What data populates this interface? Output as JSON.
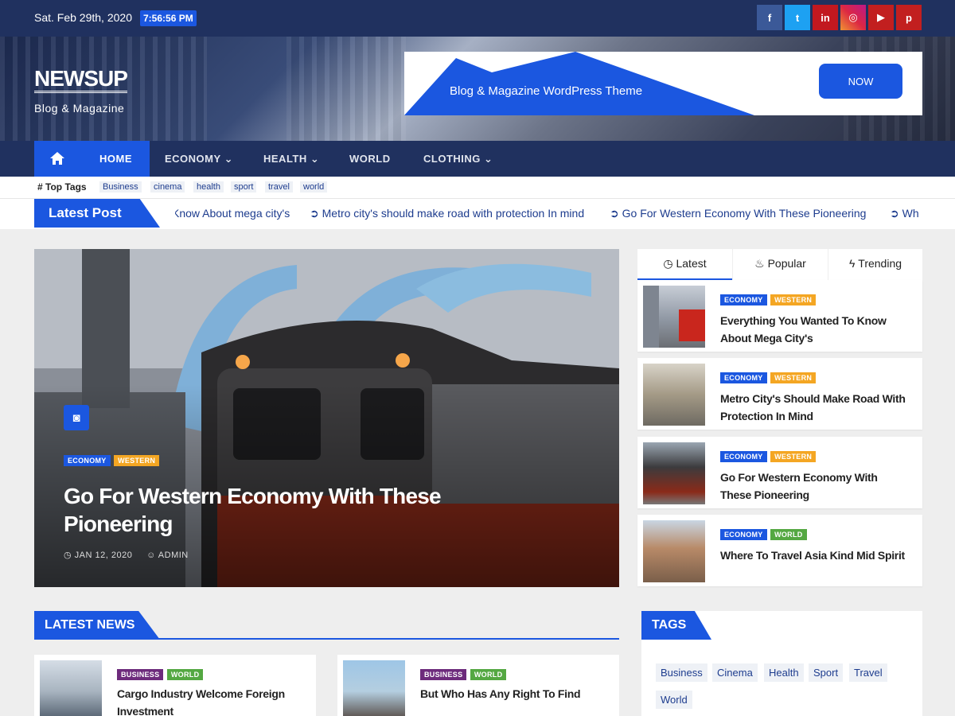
{
  "topbar": {
    "date": "Sat. Feb 29th, 2020",
    "time": "7:56:56 PM"
  },
  "social": [
    {
      "name": "facebook-icon",
      "glyph": "f",
      "color": "#3b5998"
    },
    {
      "name": "twitter-icon",
      "glyph": "t",
      "color": "#1da1f2"
    },
    {
      "name": "linkedin-icon",
      "glyph": "in",
      "color": "#c2181f"
    },
    {
      "name": "instagram-icon",
      "glyph": "◎",
      "color": "#d6249f"
    },
    {
      "name": "youtube-icon",
      "glyph": "▶",
      "color": "#c21f1f"
    },
    {
      "name": "pinterest-icon",
      "glyph": "p",
      "color": "#c21f1f"
    }
  ],
  "brand": {
    "name": "NEWSUP",
    "tagline": "Blog & Magazine"
  },
  "ad": {
    "text": "Blog & Magazine WordPress Theme",
    "button": "NOW"
  },
  "nav": {
    "home": "HOME",
    "economy": "ECONOMY",
    "health": "HEALTH",
    "world": "WORLD",
    "clothing": "CLOTHING"
  },
  "top_tags": {
    "label": "Top Tags",
    "items": [
      "Business",
      "cinema",
      "health",
      "sport",
      "travel",
      "world"
    ]
  },
  "ticker": {
    "label": "Latest Post",
    "items": [
      "Know About mega city's",
      "Metro city's should make road with protection In mind",
      "Go For Western Economy With These Pioneering",
      "Wh"
    ]
  },
  "feature": {
    "cat1": "ECONOMY",
    "cat2": "WESTERN",
    "title": "Go For Western Economy With These Pioneering",
    "date": "JAN 12, 2020",
    "author": "ADMIN"
  },
  "sidebar": {
    "tabs": [
      "Latest",
      "Popular",
      "Trending"
    ],
    "posts": [
      {
        "cat1": "ECONOMY",
        "cat2": "WESTERN",
        "title": "Everything You Wanted To Know About Mega City's"
      },
      {
        "cat1": "ECONOMY",
        "cat2": "WESTERN",
        "title": "Metro City's Should Make Road With Protection In Mind"
      },
      {
        "cat1": "ECONOMY",
        "cat2": "WESTERN",
        "title": "Go For Western Economy With These Pioneering"
      },
      {
        "cat1": "ECONOMY",
        "cat2": "WORLD",
        "title": "Where To Travel Asia Kind Mid Spirit"
      }
    ]
  },
  "latest_news": {
    "heading": "LATEST NEWS",
    "posts": [
      {
        "cat1": "BUSINESS",
        "cat2": "WORLD",
        "title": "Cargo Industry Welcome Foreign Investment"
      },
      {
        "cat1": "BUSINESS",
        "cat2": "WORLD",
        "title": "But Who Has Any Right To Find"
      }
    ]
  },
  "tags_widget": {
    "heading": "TAGS",
    "items": [
      "Business",
      "Cinema",
      "Health",
      "Sport",
      "Travel",
      "World"
    ]
  }
}
